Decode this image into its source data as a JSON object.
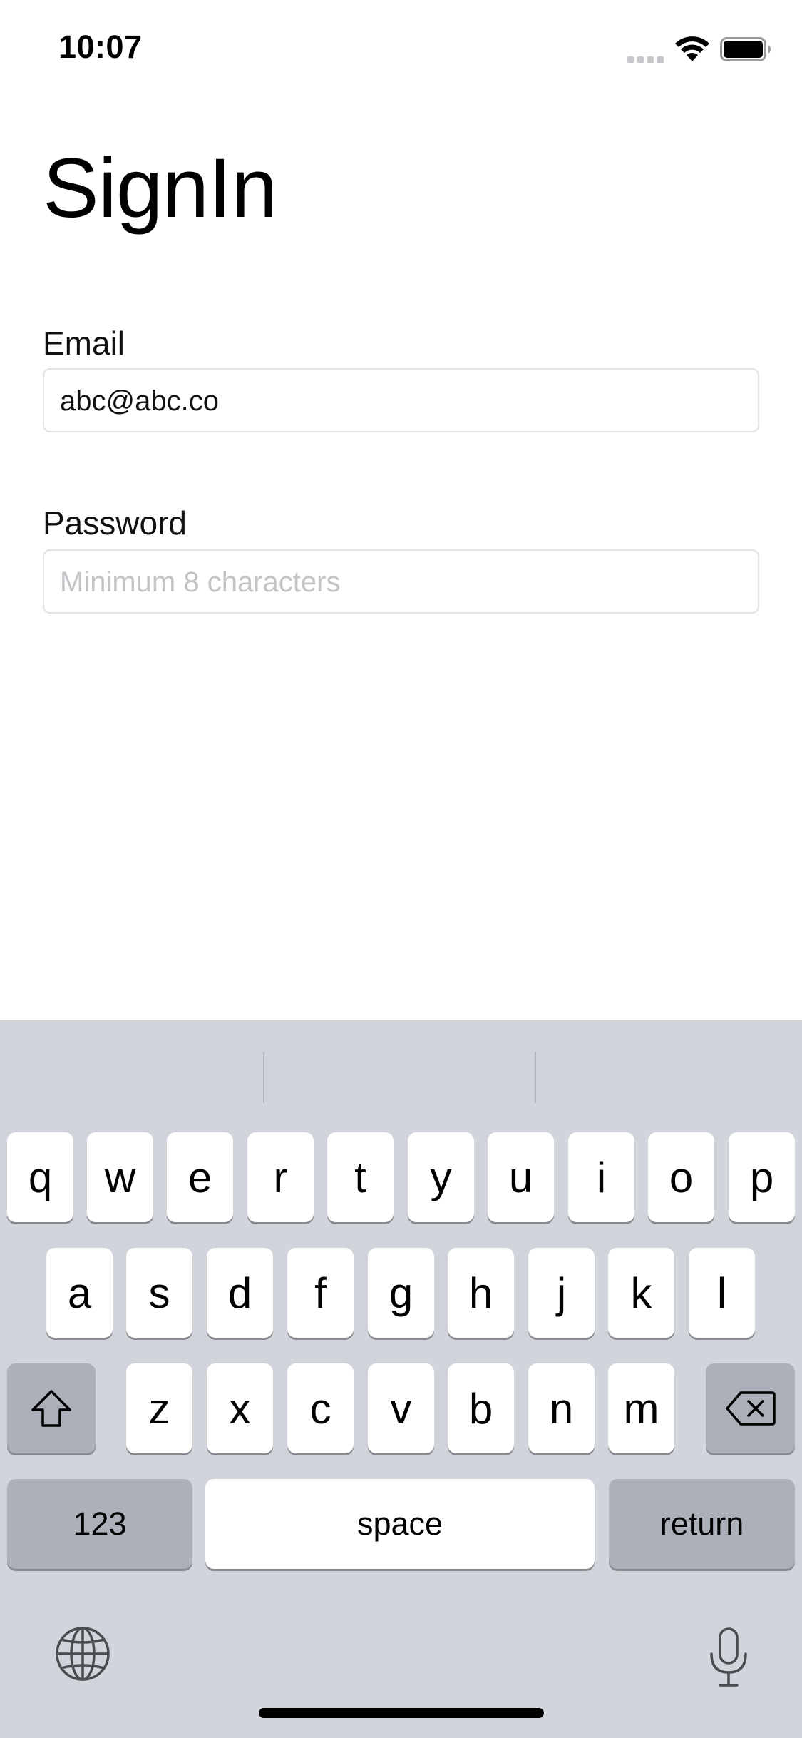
{
  "status_bar": {
    "time": "10:07",
    "icons": [
      "signal-icon",
      "wifi-icon",
      "battery-icon"
    ]
  },
  "page": {
    "title": "SignIn"
  },
  "form": {
    "email": {
      "label": "Email",
      "value": "abc@abc.co"
    },
    "password": {
      "label": "Password",
      "placeholder": "Minimum 8 characters",
      "value": ""
    }
  },
  "keyboard": {
    "row1": [
      "q",
      "w",
      "e",
      "r",
      "t",
      "y",
      "u",
      "i",
      "o",
      "p"
    ],
    "row2": [
      "a",
      "s",
      "d",
      "f",
      "g",
      "h",
      "j",
      "k",
      "l"
    ],
    "row3": [
      "z",
      "x",
      "c",
      "v",
      "b",
      "n",
      "m"
    ],
    "numbers_label": "123",
    "space_label": "space",
    "return_label": "return",
    "icons": [
      "shift-icon",
      "delete-icon",
      "globe-icon",
      "microphone-icon"
    ]
  },
  "colors": {
    "keyboard_bg": "#d1d4da",
    "key_bg": "#ffffff",
    "function_key_bg": "#acb0b9",
    "placeholder": "#c4c4c8"
  }
}
